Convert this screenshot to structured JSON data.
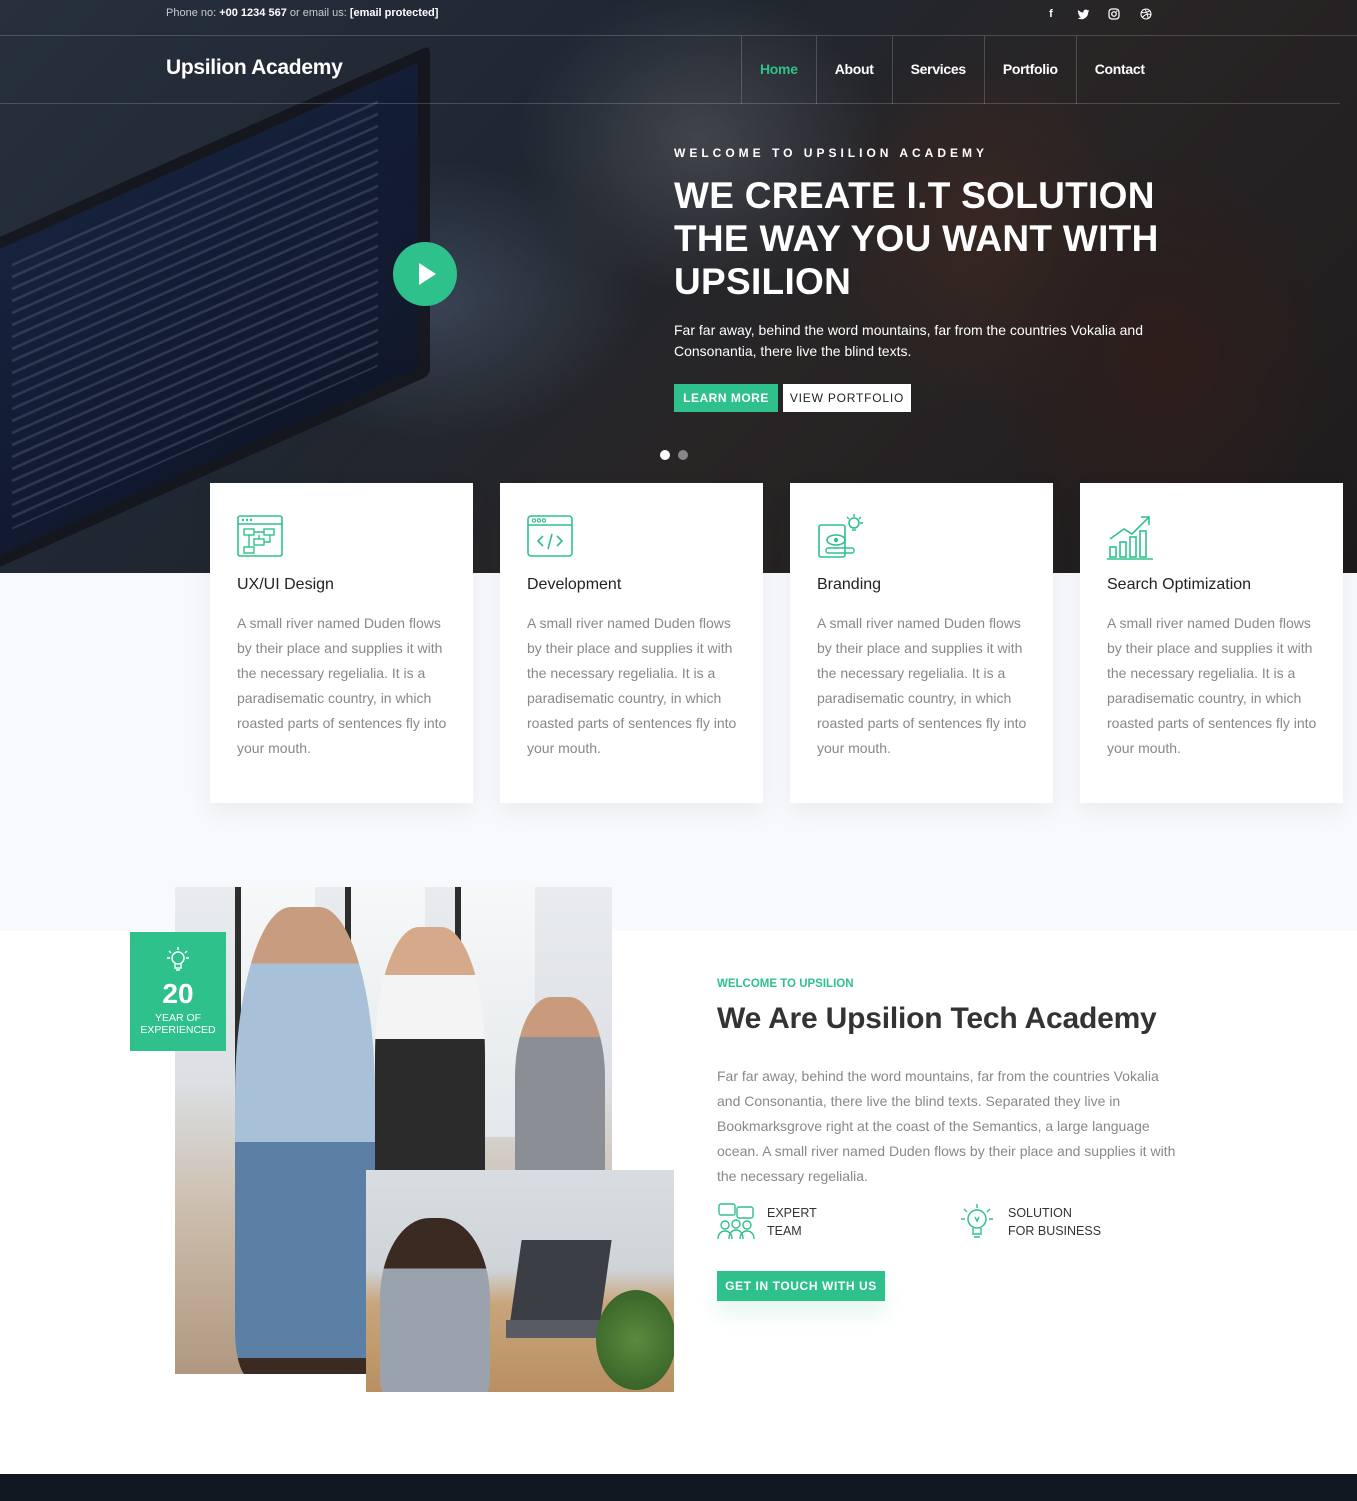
{
  "topbar": {
    "contact_prefix": "Phone no:",
    "phone": "+00 1234 567",
    "contact_mid": "or email us:",
    "email": "[email protected]",
    "social_icons": [
      "facebook-icon",
      "twitter-icon",
      "instagram-icon",
      "dribbble-icon"
    ]
  },
  "navbar": {
    "brand": "Upsilion Academy",
    "items": [
      {
        "label": "Home",
        "active": true
      },
      {
        "label": "About",
        "active": false
      },
      {
        "label": "Services",
        "active": false
      },
      {
        "label": "Portfolio",
        "active": false
      },
      {
        "label": "Contact",
        "active": false
      }
    ]
  },
  "hero": {
    "subheading": "WELCOME TO UPSILION ACADEMY",
    "title": "WE CREATE I.T SOLUTION THE WAY YOU WANT WITH UPSILION",
    "text": "Far far away, behind the word mountains, far from the countries Vokalia and Consonantia, there live the blind texts.",
    "primary_button": "LEARN MORE",
    "secondary_button": "VIEW PORTFOLIO",
    "slides": 2,
    "active_slide": 1
  },
  "services": [
    {
      "icon": "ux-design-icon",
      "title": "UX/UI Design",
      "text": "A small river named Duden flows by their place and supplies it with the necessary regelialia. It is a paradisematic country, in which roasted parts of sentences fly into your mouth."
    },
    {
      "icon": "code-icon",
      "title": "Development",
      "text": "A small river named Duden flows by their place and supplies it with the necessary regelialia. It is a paradisematic country, in which roasted parts of sentences fly into your mouth."
    },
    {
      "icon": "branding-icon",
      "title": "Branding",
      "text": "A small river named Duden flows by their place and supplies it with the necessary regelialia. It is a paradisematic country, in which roasted parts of sentences fly into your mouth."
    },
    {
      "icon": "growth-chart-icon",
      "title": "Search Optimization",
      "text": "A small river named Duden flows by their place and supplies it with the necessary regelialia. It is a paradisematic country, in which roasted parts of sentences fly into your mouth."
    }
  ],
  "about": {
    "badge_number": "20",
    "badge_label_1": "YEAR OF",
    "badge_label_2": "EXPERIENCED",
    "subheading": "WELCOME TO UPSILION",
    "title": "We Are Upsilion Tech Academy",
    "text": "Far far away, behind the word mountains, far from the countries Vokalia and Consonantia, there live the blind texts. Separated they live in Bookmarksgrove right at the coast of the Semantics, a large language ocean. A small river named Duden flows by their place and supplies it with the necessary regelialia.",
    "features": [
      {
        "icon": "expert-team-icon",
        "line1": "EXPERT",
        "line2": "TEAM"
      },
      {
        "icon": "lightbulb-icon",
        "line1": "SOLUTION",
        "line2": "FOR BUSINESS"
      }
    ],
    "button": "GET IN TOUCH WITH US"
  },
  "colors": {
    "accent": "#2fc18c",
    "dark_footer": "#111821",
    "light_bg": "#f8f9fd"
  }
}
